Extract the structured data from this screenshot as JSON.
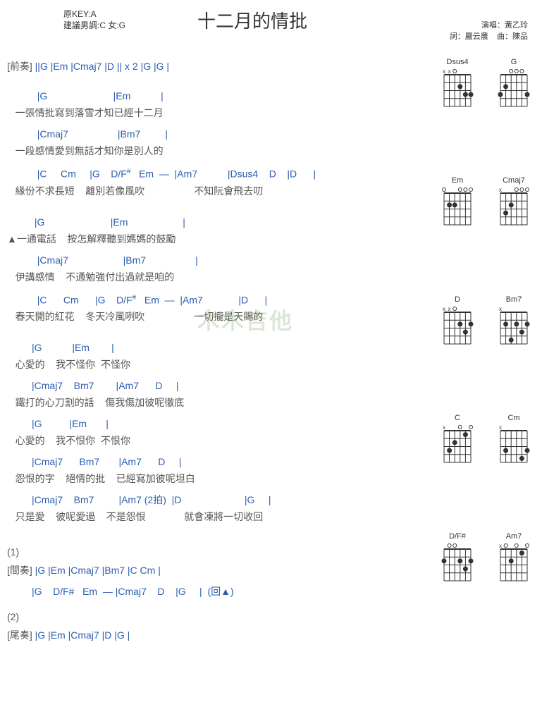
{
  "header": {
    "original_key": "原KEY:A",
    "suggested_keys": "建議男調:C 女:G",
    "title": "十二月的情批",
    "artist_label": "演唱：黃乙玲",
    "lyricist_label": "詞：嚴云農",
    "composer_label": "曲：陳品"
  },
  "intro": {
    "label": "[前奏]",
    "seq": " ||G    |Em    |Cmaj7   |D     || x 2   |G    |G    |"
  },
  "lines": [
    {
      "chords": "           |G                        |Em           |",
      "lyrics": "   一張情批寫到落雪才知已經十二月"
    },
    {
      "chords": "           |Cmaj7                  |Bm7         |",
      "lyrics": "   一段感情愛到無話才知你是別人的"
    },
    {
      "chords": "           |C     Cm     |G    D/F#   Em  —  |Am7           |Dsus4    D    |D      |",
      "lyrics": "   緣份不求長短    離別若像風吹                  不知阮會飛去叨"
    },
    {
      "chords": "          |G                        |Em                    |",
      "lyrics": "▲一通電話    按怎解釋聽到媽媽的鼓勵"
    },
    {
      "chords": "           |Cmaj7                    |Bm7                  |",
      "lyrics": "   伊講感情    不通勉強付出過就是咱的"
    },
    {
      "chords": "           |C      Cm      |G    D/F#   Em  —  |Am7             |D      |",
      "lyrics": "   春天開的紅花    冬天冷風咧吹                  一切攏是天賜的"
    },
    {
      "chords": "         |G           |Em        |",
      "lyrics": "   心愛的    我不怪你  不怪你"
    },
    {
      "chords": "         |Cmaj7    Bm7        |Am7      D     |",
      "lyrics": "   鐵打的心刀割的話    傷我傷加彼呢徹底"
    },
    {
      "chords": "         |G          |Em       |",
      "lyrics": "   心愛的    我不恨你  不恨你"
    },
    {
      "chords": "         |Cmaj7      Bm7       |Am7      D     |",
      "lyrics": "   怨恨的字    絕情的批    已經寫加彼呢坦白"
    },
    {
      "chords": "         |Cmaj7    Bm7         |Am7 (2拍)  |D                       |G     |",
      "lyrics": "   只是愛    彼呢愛過    不是怨恨              就會凍將一切收回"
    }
  ],
  "section1": {
    "label": "(1)",
    "interlude_label": "[間奏]",
    "interlude_seq": " |G    |Em    |Cmaj7    |Bm7    |C    Cm    |",
    "interlude_seq2": "         |G    D/F#   Em  — |Cmaj7    D    |G     |  (回▲)"
  },
  "section2": {
    "label": "(2)",
    "outro_label": "[尾奏]",
    "outro_seq": " |G    |Em    |Cmaj7    |D     |G     |"
  },
  "diagrams": [
    "Dsus4",
    "G",
    "Em",
    "Cmaj7",
    "D",
    "Bm7",
    "C",
    "Cm",
    "D/F#",
    "Am7"
  ],
  "watermark": "木木吉他"
}
